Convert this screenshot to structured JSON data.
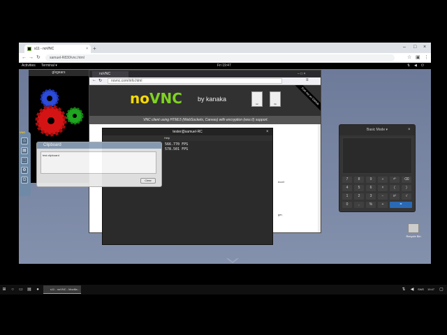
{
  "browser": {
    "tab_title": "s11 - noVNC",
    "tab_close": "×",
    "new_tab": "+",
    "address": "samuel-R830/vnc.html",
    "window_controls": [
      "–",
      "□",
      "×"
    ]
  },
  "gnome": {
    "activities": "Activities",
    "app_menu": "Terminal ▾",
    "clock": "Fri 19:47"
  },
  "glxgears": {
    "title": "glxgears"
  },
  "novnc_sidebar": {
    "logo": "VNC",
    "buttons": [
      "⌂",
      "▤",
      "⬚",
      "⚙",
      "⏻"
    ]
  },
  "clipboard": {
    "title": "Clipboard",
    "text": "test clipboard",
    "clear_label": "Clear"
  },
  "inner_firefox": {
    "tab_title": "noVNC",
    "url": "novnc.com/info.html",
    "logo_no": "no",
    "logo_vnc": "VNC",
    "by": "by kanaka",
    "downloads": [
      "tar",
      "zip"
    ],
    "ribbon": "Fork me on GitHub",
    "tagline": "VNC client using HTML5 (WebSockets, Canvas) with encryption (wss://) support.",
    "fragments": [
      "ecort",
      "ger,",
      "page"
    ]
  },
  "terminal": {
    "title": "tester@samuel-RC",
    "menu_item": "Help",
    "lines": [
      "566.770 FPS",
      "578.501 FPS"
    ]
  },
  "calculator": {
    "title": "Basic Mode ▾",
    "close": "×",
    "keys": [
      "7",
      "8",
      "9",
      "÷",
      "↶",
      "⌫",
      "4",
      "5",
      "6",
      "×",
      "(",
      ")",
      "1",
      "2",
      "3",
      "−",
      "x²",
      "√",
      "0",
      ",",
      "%",
      "+",
      "="
    ]
  },
  "recycle": {
    "label": "Recycle Bin"
  },
  "taskbar": {
    "active_window": "s11 - noVNC - Mozilla...",
    "lang": "SWE",
    "time": "19:47"
  },
  "colors": {
    "novnc_green": "#7fd321",
    "novnc_yellow": "#f5d90a",
    "calc_accent": "#2a6ab5"
  }
}
